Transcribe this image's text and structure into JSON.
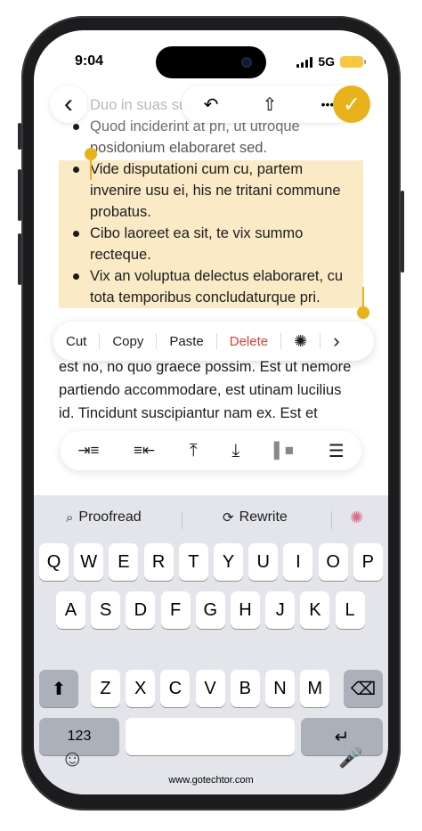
{
  "status_bar": {
    "time": "9:04",
    "network": "5G"
  },
  "toolbar": {
    "back_icon": "‹",
    "undo_icon": "↶",
    "share_icon": "⇧",
    "more_icon": "•••",
    "done_icon": "✓"
  },
  "note": {
    "faded_line_1": "Duo in suas sui...",
    "line_quod_1": "Quod inciderint at pri, ut utroque",
    "line_quod_2": "posidonium elaboraret sed.",
    "line_vide_1": "Vide disputationi cum cu, partem",
    "line_vide_2": "invenire usu ei, his ne tritani commune",
    "line_vide_3": "probatus.",
    "line_cibo_1": "Cibo laoreet ea sit, te vix summo",
    "line_cibo_2": "recteque.",
    "line_vix_1": "Vix an voluptua delectus elaboraret, cu",
    "line_vix_2": "tota temporibus concludaturque pri.",
    "line_est_1": "est no, no quo graece possim. Est ut nemore",
    "line_est_2": "partiendo accommodare, est utinam lucilius",
    "line_est_3": "id. Tincidunt suscipiantur nam ex. Est et"
  },
  "edit_menu": {
    "cut": "Cut",
    "copy": "Copy",
    "paste": "Paste",
    "delete": "Delete",
    "ai_icon": "✺",
    "next_icon": "›"
  },
  "format_bar": {
    "indent_icon": "⇥≡",
    "outdent_icon": "≡⇤",
    "move_top_icon": "⤒",
    "move_down_icon": "⤓",
    "block_icon": "▌■",
    "list_style_icon": "☰"
  },
  "keyboard": {
    "proofread": "Proofread",
    "rewrite": "Rewrite",
    "row1": [
      "Q",
      "W",
      "E",
      "R",
      "T",
      "Y",
      "U",
      "I",
      "O",
      "P"
    ],
    "row2": [
      "A",
      "S",
      "D",
      "F",
      "G",
      "H",
      "J",
      "K",
      "L"
    ],
    "row3": [
      "Z",
      "X",
      "C",
      "V",
      "B",
      "N",
      "M"
    ],
    "numbers": "123",
    "shift_icon": "⬆",
    "backspace_icon": "⌫",
    "return_icon": "↵",
    "emoji_icon": "☺",
    "mic_icon": "🎙"
  },
  "watermark": "www.gotechtor.com",
  "colors": {
    "accent": "#e7b21a",
    "highlight": "#faebc6",
    "delete": "#e23b30"
  }
}
